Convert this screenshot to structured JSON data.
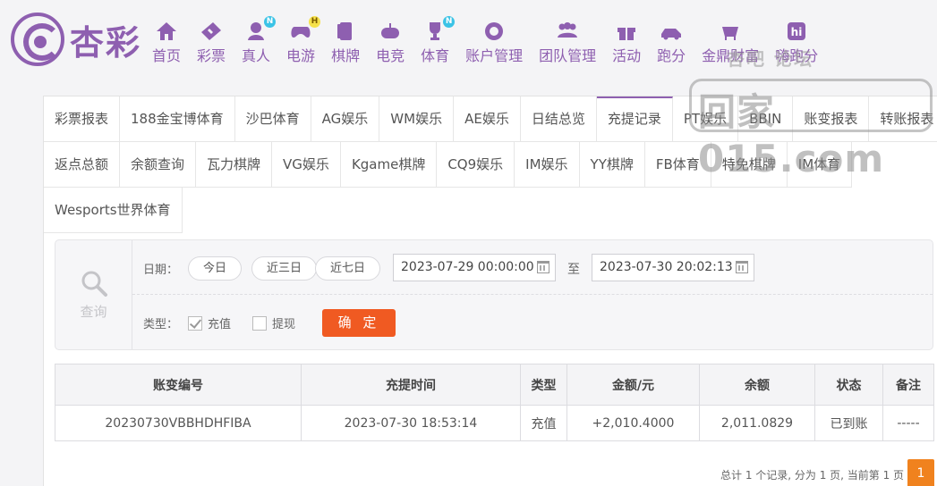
{
  "brand": {
    "name": "杏彩"
  },
  "nav": [
    {
      "label": "首页",
      "icon": "home-icon",
      "badge": ""
    },
    {
      "label": "彩票",
      "icon": "lottery-ticket-icon",
      "badge": ""
    },
    {
      "label": "真人",
      "icon": "live-dealer-icon",
      "badge": "N"
    },
    {
      "label": "电游",
      "icon": "gamepad-icon",
      "badge": "H"
    },
    {
      "label": "棋牌",
      "icon": "cards-icon",
      "badge": ""
    },
    {
      "label": "电竞",
      "icon": "esports-controller-icon",
      "badge": ""
    },
    {
      "label": "体育",
      "icon": "trophy-icon",
      "badge": "N"
    },
    {
      "label": "账户管理",
      "icon": "account-icon",
      "badge": ""
    },
    {
      "label": "团队管理",
      "icon": "team-icon",
      "badge": ""
    },
    {
      "label": "活动",
      "icon": "gift-icon",
      "badge": ""
    },
    {
      "label": "跑分",
      "icon": "car-icon",
      "badge": ""
    },
    {
      "label": "金鼎财富",
      "icon": "cauldron-icon",
      "badge": ""
    },
    {
      "label": "嗨跑分",
      "icon": "hi-icon",
      "badge": ""
    }
  ],
  "watermark": {
    "top": "杏吧  论坛",
    "main": "回家015.com"
  },
  "tabs": {
    "row1": [
      "彩票报表",
      "188金宝博体育",
      "沙巴体育",
      "AG娱乐",
      "WM娱乐",
      "AE娱乐",
      "日结总览",
      "充提记录",
      "PT娱乐",
      "BBIN",
      "账变报表",
      "转账报表"
    ],
    "row2": [
      "返点总额",
      "余额查询",
      "瓦力棋牌",
      "VG娱乐",
      "Kgame棋牌",
      "CQ9娱乐",
      "IM娱乐",
      "YY棋牌",
      "FB体育",
      "特免棋牌",
      "IM体育"
    ],
    "row3": [
      "Wesports世界体育"
    ],
    "active": "充提记录"
  },
  "query": {
    "side_label": "查询",
    "date_label": "日期：",
    "quick": [
      "今日",
      "近三日",
      "近七日"
    ],
    "start_date": "2023-07-29 00:00:00",
    "to": "至",
    "end_date": "2023-07-30 20:02:13",
    "type_label": "类型：",
    "types": [
      {
        "label": "充值",
        "checked": true
      },
      {
        "label": "提现",
        "checked": false
      }
    ],
    "confirm": "确 定"
  },
  "table": {
    "headers": [
      "账变编号",
      "充提时间",
      "类型",
      "金额/元",
      "余额",
      "状态",
      "备注"
    ],
    "rows": [
      [
        "20230730VBBHDHFIBA",
        "2023-07-30 18:53:14",
        "充值",
        "+2,010.4000",
        "2,011.0829",
        "已到账",
        "-----"
      ]
    ]
  },
  "pager": {
    "info": "总计 1 个记录, 分为 1 页, 当前第 1 页",
    "current": "1"
  },
  "colors": {
    "brand": "#8e5fb0",
    "confirm": "#f05a22",
    "amount": "#e02020",
    "status": "#2fa52f",
    "page": "#f0821e"
  }
}
